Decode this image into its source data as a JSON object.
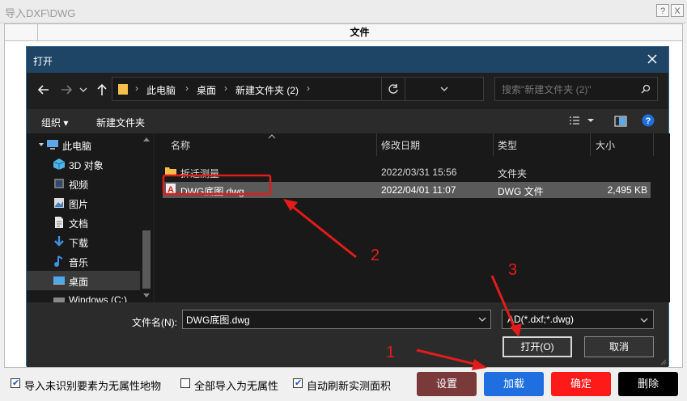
{
  "window": {
    "title": "导入DXF\\DWG",
    "help_glyph": "?",
    "close_glyph": "X"
  },
  "table": {
    "column_file": "文件"
  },
  "open_dialog": {
    "title": "打开",
    "address": {
      "crumbs": [
        "此电脑",
        "桌面",
        "新建文件夹 (2)"
      ],
      "separator": "›",
      "end_chevron": "›"
    },
    "search_placeholder": "搜索\"新建文件夹 (2)\"",
    "toolbar": {
      "organize": "组织 ▾",
      "new_folder": "新建文件夹"
    },
    "nav_items": [
      {
        "label": "此电脑",
        "icon": "computer-icon"
      },
      {
        "label": "3D 对象",
        "icon": "cube-icon"
      },
      {
        "label": "视频",
        "icon": "video-icon"
      },
      {
        "label": "图片",
        "icon": "picture-icon"
      },
      {
        "label": "文档",
        "icon": "document-icon"
      },
      {
        "label": "下载",
        "icon": "download-icon"
      },
      {
        "label": "音乐",
        "icon": "music-icon"
      },
      {
        "label": "桌面",
        "icon": "desktop-icon",
        "selected": true
      },
      {
        "label": "Windows (C:)",
        "icon": "drive-icon"
      }
    ],
    "columns": {
      "name": "名称",
      "modified": "修改日期",
      "type": "类型",
      "size": "大小"
    },
    "files": [
      {
        "name": "拆迁测量",
        "modified": "2022/03/31 15:56",
        "type": "文件夹",
        "size": "",
        "icon": "folder-icon"
      },
      {
        "name": "DWG底图.dwg",
        "modified": "2022/04/01 11:07",
        "type": "DWG 文件",
        "size": "2,495 KB",
        "icon": "dwg-file-icon",
        "selected": true
      }
    ],
    "filename_label": "文件名(N):",
    "filename_value": "DWG底图.dwg",
    "filetype_value": "AD(*.dxf;*.dwg)",
    "open_button": "打开(O)",
    "cancel_button": "取消"
  },
  "options": [
    {
      "label": "导入未识别要素为无属性地物",
      "checked": true
    },
    {
      "label": "全部导入为无属性",
      "checked": false
    },
    {
      "label": "自动刷新实测面积",
      "checked": true
    }
  ],
  "buttons": {
    "settings": "设置",
    "load": "加载",
    "confirm": "确定",
    "delete": "删除"
  },
  "button_colors": {
    "settings": "#7a3a3a",
    "load": "#1f6fe0",
    "confirm": "#ff1a1a",
    "delete": "#000000"
  },
  "annotations": {
    "color": "#e21b1b",
    "steps": [
      "1",
      "2",
      "3"
    ]
  }
}
